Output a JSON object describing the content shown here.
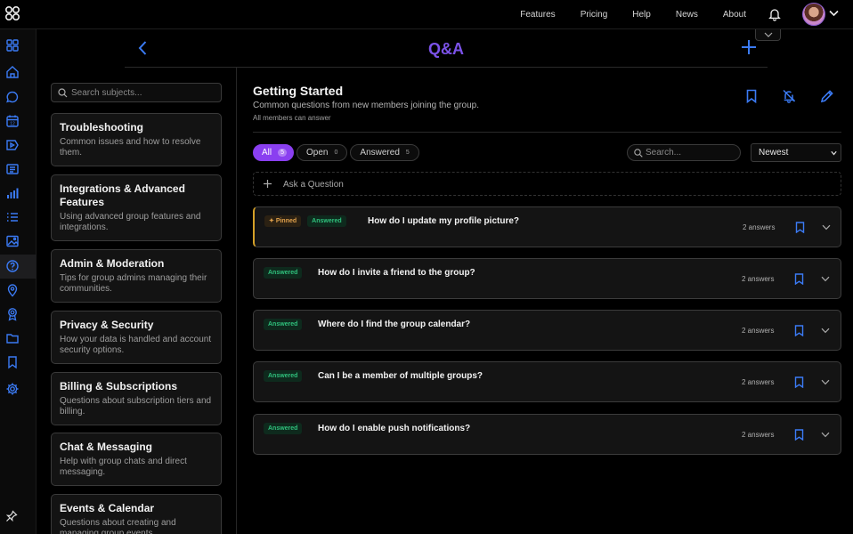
{
  "topnav": {
    "links": [
      "Features",
      "Pricing",
      "Help",
      "News",
      "About"
    ]
  },
  "header": {
    "title": "Q&A"
  },
  "subjects": {
    "search_placeholder": "Search subjects...",
    "items": [
      {
        "title": "Troubleshooting",
        "desc": "Common issues and how to resolve them."
      },
      {
        "title": "Integrations & Advanced Features",
        "desc": "Using advanced group features and integrations."
      },
      {
        "title": "Admin & Moderation",
        "desc": "Tips for group admins managing their communities."
      },
      {
        "title": "Privacy & Security",
        "desc": "How your data is handled and account security options."
      },
      {
        "title": "Billing & Subscriptions",
        "desc": "Questions about subscription tiers and billing."
      },
      {
        "title": "Chat & Messaging",
        "desc": "Help with group chats and direct messaging."
      },
      {
        "title": "Events & Calendar",
        "desc": "Questions about creating and managing group events."
      }
    ]
  },
  "main": {
    "title": "Getting Started",
    "description": "Common questions from new members joining the group.",
    "subtitle": "All members can answer",
    "tabs": [
      {
        "label": "All",
        "count": "5"
      },
      {
        "label": "Open",
        "count": "0"
      },
      {
        "label": "Answered",
        "count": "5"
      }
    ],
    "search_placeholder": "Search...",
    "sort": "Newest",
    "ask_label": "Ask a Question",
    "pinned_label": "Pinned",
    "questions": [
      {
        "status": "Answered",
        "title": "How do I update my profile picture?",
        "answers": "2 answers",
        "pinned": true
      },
      {
        "status": "Answered",
        "title": "How do I invite a friend to the group?",
        "answers": "2 answers"
      },
      {
        "status": "Answered",
        "title": "Where do I find the group calendar?",
        "answers": "2 answers"
      },
      {
        "status": "Answered",
        "title": "Can I be a member of multiple groups?",
        "answers": "2 answers"
      },
      {
        "status": "Answered",
        "title": "How do I enable push notifications?",
        "answers": "2 answers"
      }
    ]
  },
  "colors": {
    "accent_purple": "#8a3ff0",
    "title_purple": "#7b52e8",
    "icon_blue": "#3b7bf5",
    "answered_green": "#2fc07c",
    "pinned_gold": "#d4a028"
  },
  "rail_icons": [
    "dashboard-icon",
    "home-icon",
    "chat-icon",
    "calendar-icon",
    "video-icon",
    "news-icon",
    "chart-icon",
    "list-icon",
    "gallery-icon",
    "help-icon",
    "location-icon",
    "badge-icon",
    "folder-icon",
    "bookmark-icon",
    "settings-icon",
    "pin-icon"
  ]
}
